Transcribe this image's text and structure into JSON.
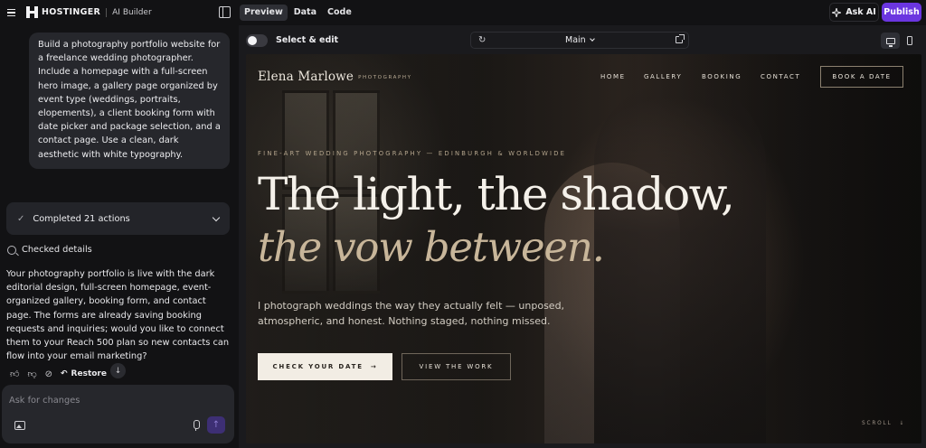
{
  "app": {
    "brand_name": "HOSTINGER",
    "brand_sub": "AI Builder",
    "tabs": [
      {
        "label": "Preview",
        "active": true
      },
      {
        "label": "Data",
        "active": false
      },
      {
        "label": "Code",
        "active": false
      }
    ],
    "ask_ai_label": "Ask AI",
    "publish_label": "Publish",
    "accent_color": "#6b36e0"
  },
  "chat": {
    "user_prompt": "Build a photography portfolio website for a freelance wedding photographer. Include a homepage with a full-screen hero image, a gallery page organized by event type (weddings, portraits, elopements), a client booking form with date picker and package selection, and a contact page. Use a clean, dark aesthetic with white typography.",
    "actions_summary": "Completed 21 actions",
    "checked_label": "Checked details",
    "assistant_reply": "Your photography portfolio is live with the dark editorial design, full-screen homepage, event-organized gallery, booking form, and contact page. The forms are already saving booking requests and inquiries; would you like to connect them to your Reach 500 plan so new contacts can flow into your email marketing?",
    "restore_label": "Restore",
    "composer_placeholder": "Ask for changes"
  },
  "preview": {
    "select_edit_label": "Select & edit",
    "page_selector": "Main"
  },
  "site": {
    "brand": "Elena Marlowe",
    "brand_sub": "PHOTOGRAPHY",
    "nav": [
      "HOME",
      "GALLERY",
      "BOOKING",
      "CONTACT"
    ],
    "book_cta": "BOOK A DATE",
    "eyebrow": "FINE-ART WEDDING PHOTOGRAPHY — EDINBURGH & WORLDWIDE",
    "headline_1": "The light, the shadow,",
    "headline_2": "the vow between.",
    "lead": "I photograph weddings the way they actually felt — unposed, atmospheric, and honest. Nothing staged, nothing missed.",
    "cta_primary": "CHECK YOUR DATE",
    "cta_secondary": "VIEW THE WORK",
    "scroll_label": "SCROLL"
  },
  "icons": {
    "menu": "menu-icon",
    "panel": "panel-toggle-icon",
    "sparkle": "sparkle-icon",
    "reload": "reload-icon",
    "external": "external-link-icon",
    "desktop": "desktop-icon",
    "mobile": "mobile-icon"
  }
}
